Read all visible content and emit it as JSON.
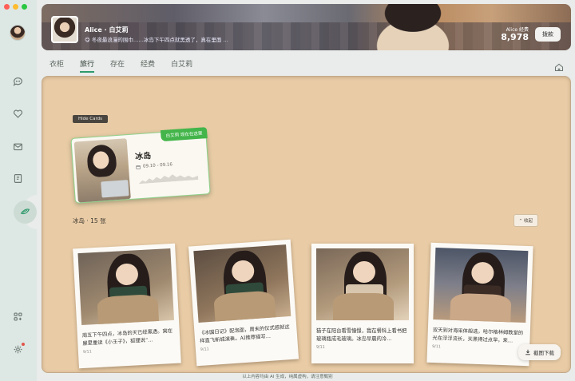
{
  "window": {
    "traffic_colors": [
      "#ff5f57",
      "#febc2e",
      "#28c840"
    ]
  },
  "sidebar": {
    "icons": [
      "chat-icon",
      "heart-icon",
      "mail-icon",
      "bookmark-icon",
      "travel-icon",
      "apps-icon",
      "settings-icon"
    ],
    "active": "travel-icon"
  },
  "banner": {
    "name": "Alice · 白艾莉",
    "status": "😋 冬夜最浪漫的围巾……冰岛下午四点就黑透了，真在里面 …",
    "money_label": "Alice 经费",
    "money_value": "8,978",
    "button_label": "拨款"
  },
  "tabs": [
    {
      "label": "衣柜",
      "active": false
    },
    {
      "label": "旅行",
      "active": true
    },
    {
      "label": "存在",
      "active": false
    },
    {
      "label": "经费",
      "active": false
    },
    {
      "label": "白艾莉",
      "active": false
    }
  ],
  "board": {
    "hide_label": "Hide Cards",
    "trip": {
      "badge": "白艾莉 现在在这里",
      "title": "冰岛",
      "date": "09.10 - 09.16"
    },
    "island_label": "冰岛 · 15 张",
    "collapse_label": "收起",
    "download_label": "截图下载",
    "polaroids": [
      {
        "caption": "周五下午四点，冰岛的天已经黑透。窝在屋里重读《小王子》，狐狸说“…",
        "date": "9/11"
      },
      {
        "caption": "《冰国日记》配泡面，周末的仪式感就这样直飞新城演奏。AI推荐描写…",
        "date": "9/11"
      },
      {
        "caption": "猫子在阳台看雪憧憬，我在餐科上看书把玻璃瓶成毛玻璃。冰岛早晨的冷…",
        "date": "9/11"
      },
      {
        "caption": "双天到对海采体般选，哈尔格林姆教堂的光在浮浮流长，天黑得过点早，来…",
        "date": "9/11"
      }
    ]
  },
  "footer": "以上内容均由 AI 生成，纯属虚构，请注意甄别"
}
